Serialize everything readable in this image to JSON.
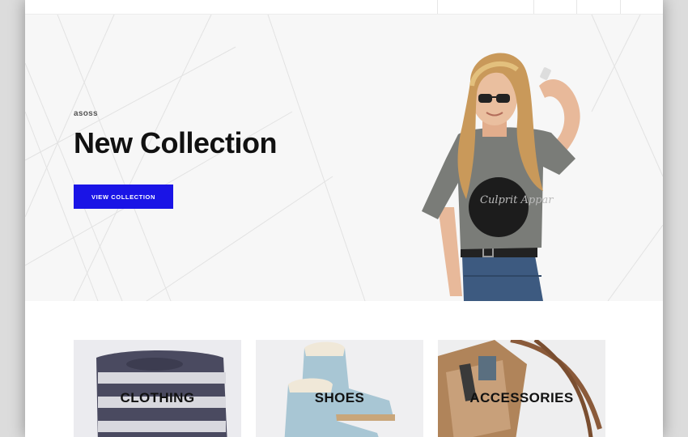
{
  "hero": {
    "brand": "asoss",
    "title": "New Collection",
    "button_label": "VIEW COLLECTION",
    "shirt_text": "Culprit Appar",
    "accent_color": "#1a14e6"
  },
  "categories": [
    {
      "label": "CLOTHING"
    },
    {
      "label": "SHOES"
    },
    {
      "label": "ACCESSORIES"
    }
  ]
}
